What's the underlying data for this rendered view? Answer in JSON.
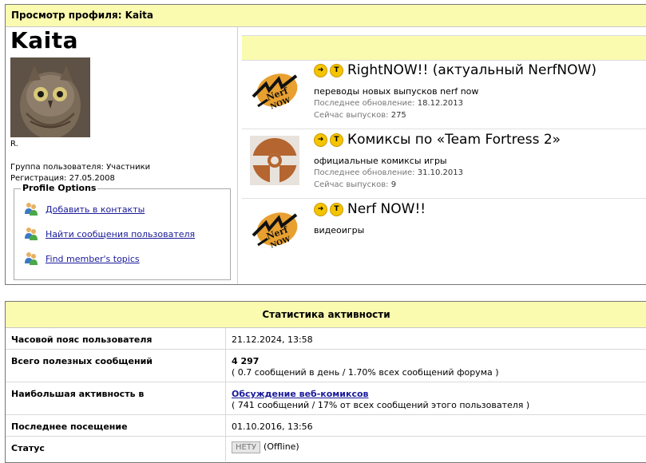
{
  "profile": {
    "header": "Просмотр профиля: Kaita",
    "username": "Kaita",
    "rank": "R.",
    "group": "Группа пользователя: Участники",
    "registered": "Регистрация: 27.05.2008",
    "options_title": "Profile Options",
    "options": [
      {
        "label": "Добавить в контакты",
        "icon": "users-icon"
      },
      {
        "label": "Найти сообщения пользователя",
        "icon": "users-icon"
      },
      {
        "label": "Find member's topics",
        "icon": "users-icon"
      }
    ]
  },
  "comics": [
    {
      "title": "RightNOW!! (актуальный NerfNOW)",
      "description": "переводы новых выпусков nerf now",
      "updated_label": "Последнее обновление:",
      "updated": "18.12.2013",
      "count_label": "Сейчас выпусков:",
      "count": "275",
      "thumb": "nerf-now-logo"
    },
    {
      "title": "Комиксы по «Team Fortress 2»",
      "description": "официальные комиксы игры",
      "updated_label": "Последнее обновление:",
      "updated": "31.10.2013",
      "count_label": "Сейчас выпусков:",
      "count": "9",
      "thumb": "tf2-logo"
    },
    {
      "title": "Nerf NOW!!",
      "description": "видеоигры",
      "thumb": "nerf-now-logo"
    }
  ],
  "stats": {
    "title": "Статистика активности",
    "timezone_label": "Часовой пояс пользователя",
    "timezone_value": "21.12.2024, 13:58",
    "posts_label": "Всего полезных сообщений",
    "posts_value": "4 297",
    "posts_detail": "( 0.7 сообщений в день / 1.70% всех сообщений форума )",
    "active_label": "Наибольшая активность в",
    "active_forum": "Обсуждение веб-комиксов",
    "active_detail": "( 741 сообщений / 17% от всех сообщений этого пользователя )",
    "last_visit_label": "Последнее посещение",
    "last_visit_value": "01.10.2016, 13:56",
    "status_label": "Статус",
    "status_badge": "НЕТУ",
    "status_text": "(Offline)"
  },
  "colors": {
    "header_bg": "#fbfbb0",
    "link": "#1a1a9a",
    "badge_yellow": "#f5c400"
  }
}
